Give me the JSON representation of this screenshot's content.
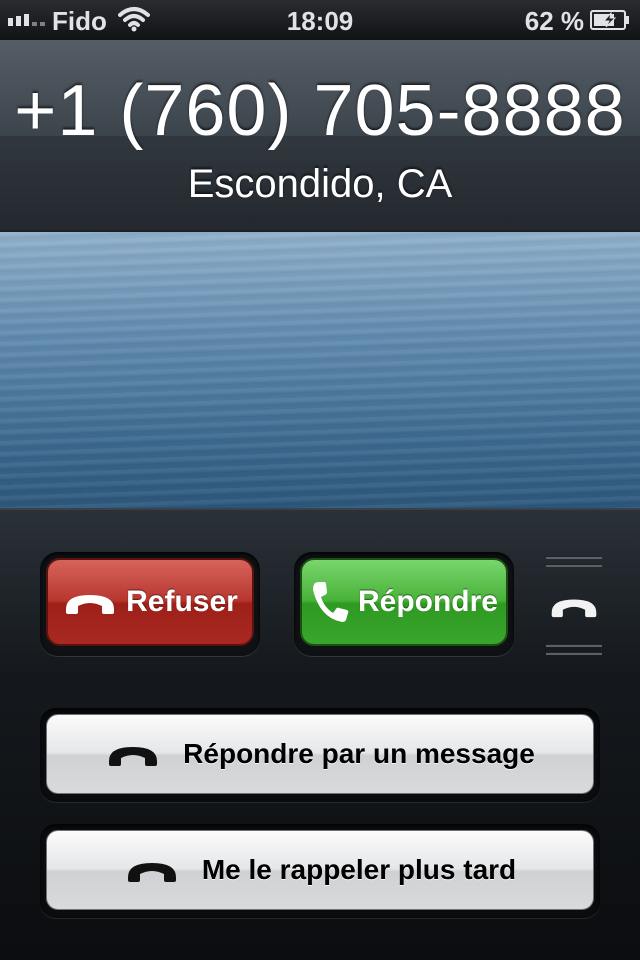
{
  "status_bar": {
    "carrier": "Fido",
    "time": "18:09",
    "battery_percent": "62 %",
    "icons": [
      "signal-icon",
      "wifi-icon",
      "battery-charging-icon"
    ]
  },
  "caller": {
    "number": "+1 (760) 705-8888",
    "location": "Escondido, CA"
  },
  "call_buttons": {
    "decline_label": "Refuser",
    "answer_label": "Répondre"
  },
  "actions": {
    "reply_message_label": "Répondre par un message",
    "remind_later_label": "Me le rappeler plus tard"
  },
  "colors": {
    "decline": "#b8372f",
    "answer": "#49b23a"
  }
}
